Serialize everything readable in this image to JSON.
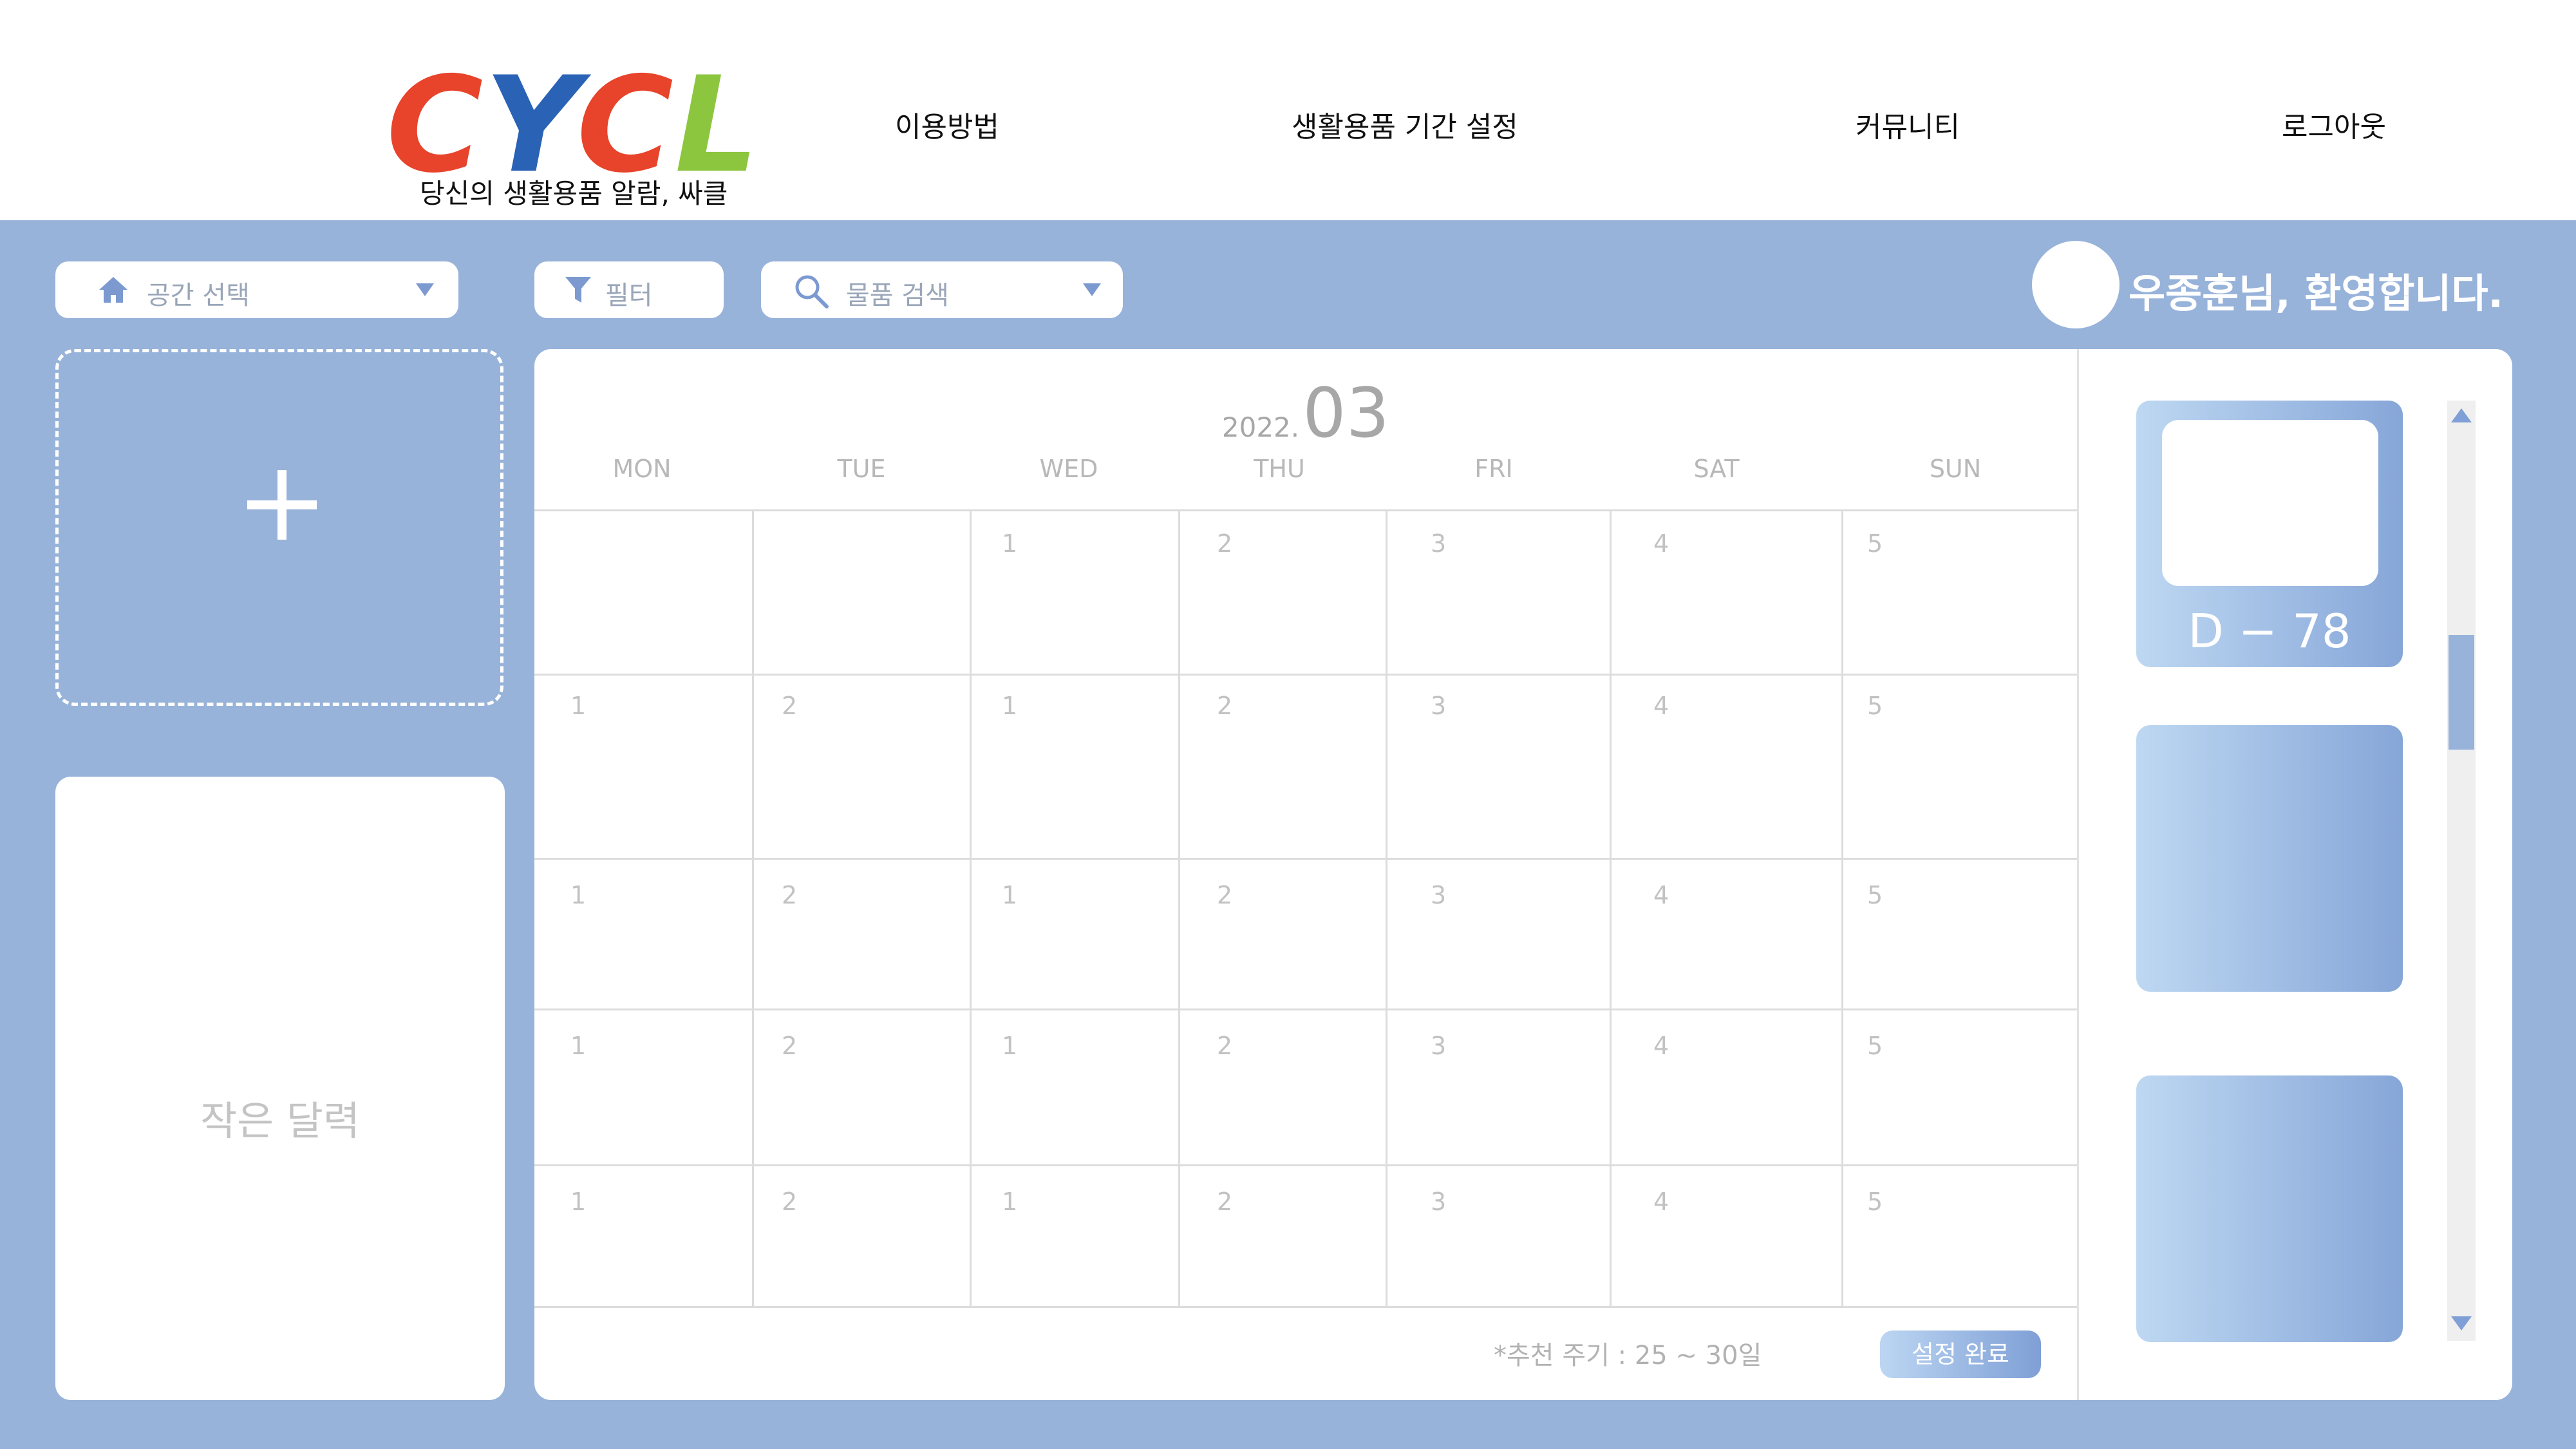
{
  "header": {
    "logo": {
      "letters": [
        {
          "char": "C",
          "color": "#e8432b"
        },
        {
          "char": "Y",
          "color": "#2a62b6"
        },
        {
          "char": "C",
          "color": "#e8432b"
        },
        {
          "char": "L",
          "color": "#8cc63f"
        }
      ],
      "tagline": "당신의 생활용품 알람, 싸클"
    },
    "nav": [
      {
        "label": "이용방법"
      },
      {
        "label": "생활용품 기간 설정"
      },
      {
        "label": "커뮤니티"
      },
      {
        "label": "로그아웃"
      }
    ]
  },
  "toolbar": {
    "space_select": {
      "placeholder": "공간 선택",
      "icon": "home-icon"
    },
    "filter": {
      "label": "필터",
      "icon": "filter-icon"
    },
    "search": {
      "placeholder": "물품 검색",
      "icon": "search-icon"
    }
  },
  "user": {
    "welcome": "우종훈님, 환영합니다."
  },
  "left": {
    "add_space_icon": "plus-icon",
    "mini_calendar_label": "작은 달력"
  },
  "calendar": {
    "year": "2022.",
    "month": "03",
    "weekdays": [
      "MON",
      "TUE",
      "WED",
      "THU",
      "FRI",
      "SAT",
      "SUN"
    ],
    "rows": [
      [
        "",
        "",
        "1",
        "2",
        "3",
        "4",
        "5"
      ],
      [
        "1",
        "2",
        "1",
        "2",
        "3",
        "4",
        "5"
      ],
      [
        "1",
        "2",
        "1",
        "2",
        "3",
        "4",
        "5"
      ],
      [
        "1",
        "2",
        "1",
        "2",
        "3",
        "4",
        "5"
      ],
      [
        "1",
        "2",
        "1",
        "2",
        "3",
        "4",
        "5"
      ]
    ],
    "recommend": "*추천 주기 : 25 ~ 30일",
    "confirm_label": "설정 완료"
  },
  "items": [
    {
      "dday": "D − 78"
    },
    {
      "dday": ""
    },
    {
      "dday": ""
    }
  ],
  "colors": {
    "background": "#98b3da",
    "accent": "#7f9fd6"
  }
}
